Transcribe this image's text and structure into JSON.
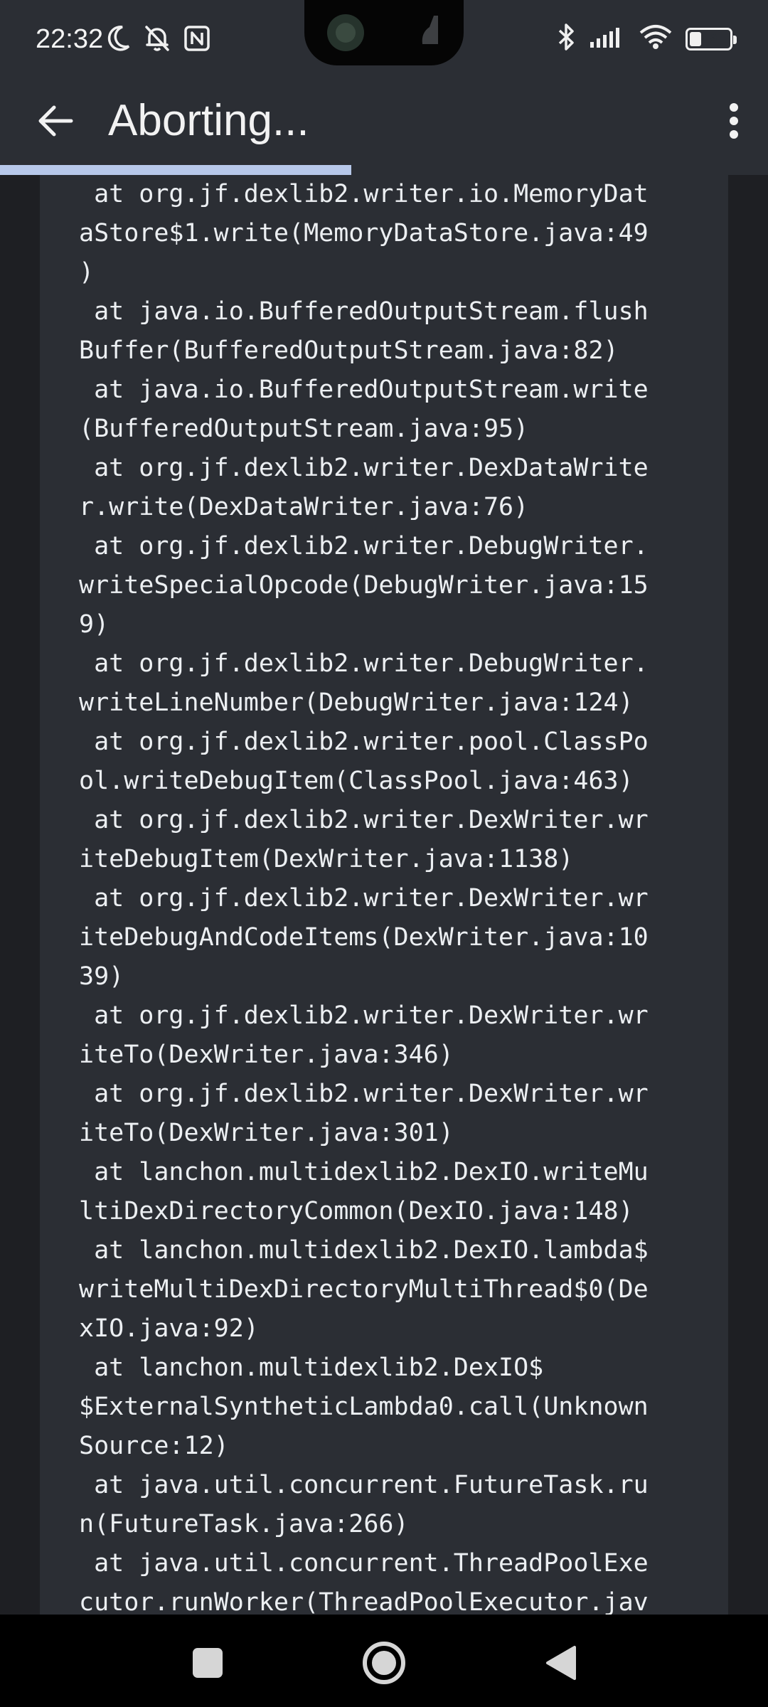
{
  "status_bar": {
    "time": "22:32",
    "battery_level": "29",
    "icons": [
      "moon-icon",
      "mute-bell-icon",
      "nfc-icon",
      "bluetooth-icon",
      "signal-icon",
      "wifi-icon",
      "battery-icon"
    ]
  },
  "app_bar": {
    "title": "Aborting...",
    "back_icon": "arrow-back-icon",
    "menu_icon": "more-vert-icon"
  },
  "progress": {
    "fraction": 0.457,
    "color": "#b7c8ea"
  },
  "log": {
    "lines": [
      " at org.jf.dexlib2.writer.io.MemoryDat",
      "aStore$1.write(MemoryDataStore.java:49",
      ")",
      " at java.io.BufferedOutputStream.flush",
      "Buffer(BufferedOutputStream.java:82)",
      " at java.io.BufferedOutputStream.write",
      "(BufferedOutputStream.java:95)",
      " at org.jf.dexlib2.writer.DexDataWrite",
      "r.write(DexDataWriter.java:76)",
      " at org.jf.dexlib2.writer.DebugWriter.",
      "writeSpecialOpcode(DebugWriter.java:15",
      "9)",
      " at org.jf.dexlib2.writer.DebugWriter.",
      "writeLineNumber(DebugWriter.java:124)",
      " at org.jf.dexlib2.writer.pool.ClassPo",
      "ol.writeDebugItem(ClassPool.java:463)",
      " at org.jf.dexlib2.writer.DexWriter.wr",
      "iteDebugItem(DexWriter.java:1138)",
      " at org.jf.dexlib2.writer.DexWriter.wr",
      "iteDebugAndCodeItems(DexWriter.java:10",
      "39)",
      " at org.jf.dexlib2.writer.DexWriter.wr",
      "iteTo(DexWriter.java:346)",
      " at org.jf.dexlib2.writer.DexWriter.wr",
      "iteTo(DexWriter.java:301)",
      " at lanchon.multidexlib2.DexIO.writeMu",
      "ltiDexDirectoryCommon(DexIO.java:148)",
      " at lanchon.multidexlib2.DexIO.lambda$",
      "writeMultiDexDirectoryMultiThread$0(De",
      "xIO.java:92)",
      " at lanchon.multidexlib2.DexIO$",
      "$ExternalSyntheticLambda0.call(Unknown",
      "Source:12)",
      " at java.util.concurrent.FutureTask.ru",
      "n(FutureTask.java:266)",
      " at java.util.concurrent.ThreadPoolExe",
      "cutor.runWorker(ThreadPoolExecutor.jav"
    ]
  },
  "nav_bar": {
    "recents_icon": "recents-square-icon",
    "home_icon": "home-circle-icon",
    "back_icon": "back-triangle-icon"
  }
}
